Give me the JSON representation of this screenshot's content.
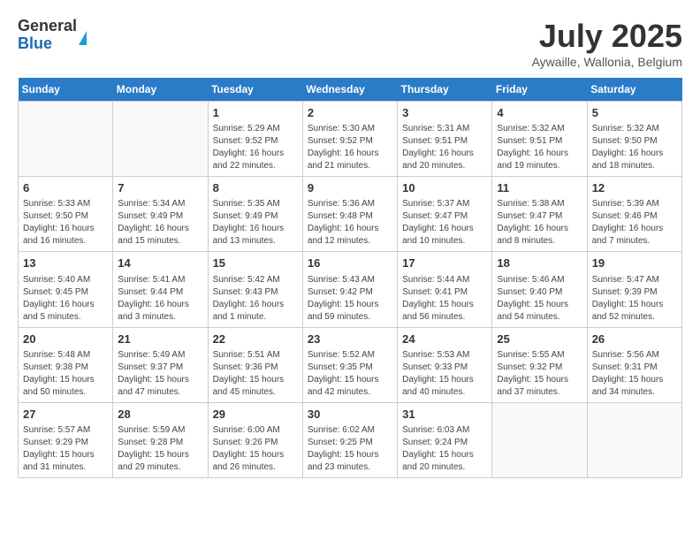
{
  "header": {
    "logo_general": "General",
    "logo_blue": "Blue",
    "title": "July 2025",
    "location": "Aywaille, Wallonia, Belgium"
  },
  "days_of_week": [
    "Sunday",
    "Monday",
    "Tuesday",
    "Wednesday",
    "Thursday",
    "Friday",
    "Saturday"
  ],
  "weeks": [
    [
      {
        "day": "",
        "info": ""
      },
      {
        "day": "",
        "info": ""
      },
      {
        "day": "1",
        "info": "Sunrise: 5:29 AM\nSunset: 9:52 PM\nDaylight: 16 hours and 22 minutes."
      },
      {
        "day": "2",
        "info": "Sunrise: 5:30 AM\nSunset: 9:52 PM\nDaylight: 16 hours and 21 minutes."
      },
      {
        "day": "3",
        "info": "Sunrise: 5:31 AM\nSunset: 9:51 PM\nDaylight: 16 hours and 20 minutes."
      },
      {
        "day": "4",
        "info": "Sunrise: 5:32 AM\nSunset: 9:51 PM\nDaylight: 16 hours and 19 minutes."
      },
      {
        "day": "5",
        "info": "Sunrise: 5:32 AM\nSunset: 9:50 PM\nDaylight: 16 hours and 18 minutes."
      }
    ],
    [
      {
        "day": "6",
        "info": "Sunrise: 5:33 AM\nSunset: 9:50 PM\nDaylight: 16 hours and 16 minutes."
      },
      {
        "day": "7",
        "info": "Sunrise: 5:34 AM\nSunset: 9:49 PM\nDaylight: 16 hours and 15 minutes."
      },
      {
        "day": "8",
        "info": "Sunrise: 5:35 AM\nSunset: 9:49 PM\nDaylight: 16 hours and 13 minutes."
      },
      {
        "day": "9",
        "info": "Sunrise: 5:36 AM\nSunset: 9:48 PM\nDaylight: 16 hours and 12 minutes."
      },
      {
        "day": "10",
        "info": "Sunrise: 5:37 AM\nSunset: 9:47 PM\nDaylight: 16 hours and 10 minutes."
      },
      {
        "day": "11",
        "info": "Sunrise: 5:38 AM\nSunset: 9:47 PM\nDaylight: 16 hours and 8 minutes."
      },
      {
        "day": "12",
        "info": "Sunrise: 5:39 AM\nSunset: 9:46 PM\nDaylight: 16 hours and 7 minutes."
      }
    ],
    [
      {
        "day": "13",
        "info": "Sunrise: 5:40 AM\nSunset: 9:45 PM\nDaylight: 16 hours and 5 minutes."
      },
      {
        "day": "14",
        "info": "Sunrise: 5:41 AM\nSunset: 9:44 PM\nDaylight: 16 hours and 3 minutes."
      },
      {
        "day": "15",
        "info": "Sunrise: 5:42 AM\nSunset: 9:43 PM\nDaylight: 16 hours and 1 minute."
      },
      {
        "day": "16",
        "info": "Sunrise: 5:43 AM\nSunset: 9:42 PM\nDaylight: 15 hours and 59 minutes."
      },
      {
        "day": "17",
        "info": "Sunrise: 5:44 AM\nSunset: 9:41 PM\nDaylight: 15 hours and 56 minutes."
      },
      {
        "day": "18",
        "info": "Sunrise: 5:46 AM\nSunset: 9:40 PM\nDaylight: 15 hours and 54 minutes."
      },
      {
        "day": "19",
        "info": "Sunrise: 5:47 AM\nSunset: 9:39 PM\nDaylight: 15 hours and 52 minutes."
      }
    ],
    [
      {
        "day": "20",
        "info": "Sunrise: 5:48 AM\nSunset: 9:38 PM\nDaylight: 15 hours and 50 minutes."
      },
      {
        "day": "21",
        "info": "Sunrise: 5:49 AM\nSunset: 9:37 PM\nDaylight: 15 hours and 47 minutes."
      },
      {
        "day": "22",
        "info": "Sunrise: 5:51 AM\nSunset: 9:36 PM\nDaylight: 15 hours and 45 minutes."
      },
      {
        "day": "23",
        "info": "Sunrise: 5:52 AM\nSunset: 9:35 PM\nDaylight: 15 hours and 42 minutes."
      },
      {
        "day": "24",
        "info": "Sunrise: 5:53 AM\nSunset: 9:33 PM\nDaylight: 15 hours and 40 minutes."
      },
      {
        "day": "25",
        "info": "Sunrise: 5:55 AM\nSunset: 9:32 PM\nDaylight: 15 hours and 37 minutes."
      },
      {
        "day": "26",
        "info": "Sunrise: 5:56 AM\nSunset: 9:31 PM\nDaylight: 15 hours and 34 minutes."
      }
    ],
    [
      {
        "day": "27",
        "info": "Sunrise: 5:57 AM\nSunset: 9:29 PM\nDaylight: 15 hours and 31 minutes."
      },
      {
        "day": "28",
        "info": "Sunrise: 5:59 AM\nSunset: 9:28 PM\nDaylight: 15 hours and 29 minutes."
      },
      {
        "day": "29",
        "info": "Sunrise: 6:00 AM\nSunset: 9:26 PM\nDaylight: 15 hours and 26 minutes."
      },
      {
        "day": "30",
        "info": "Sunrise: 6:02 AM\nSunset: 9:25 PM\nDaylight: 15 hours and 23 minutes."
      },
      {
        "day": "31",
        "info": "Sunrise: 6:03 AM\nSunset: 9:24 PM\nDaylight: 15 hours and 20 minutes."
      },
      {
        "day": "",
        "info": ""
      },
      {
        "day": "",
        "info": ""
      }
    ]
  ]
}
